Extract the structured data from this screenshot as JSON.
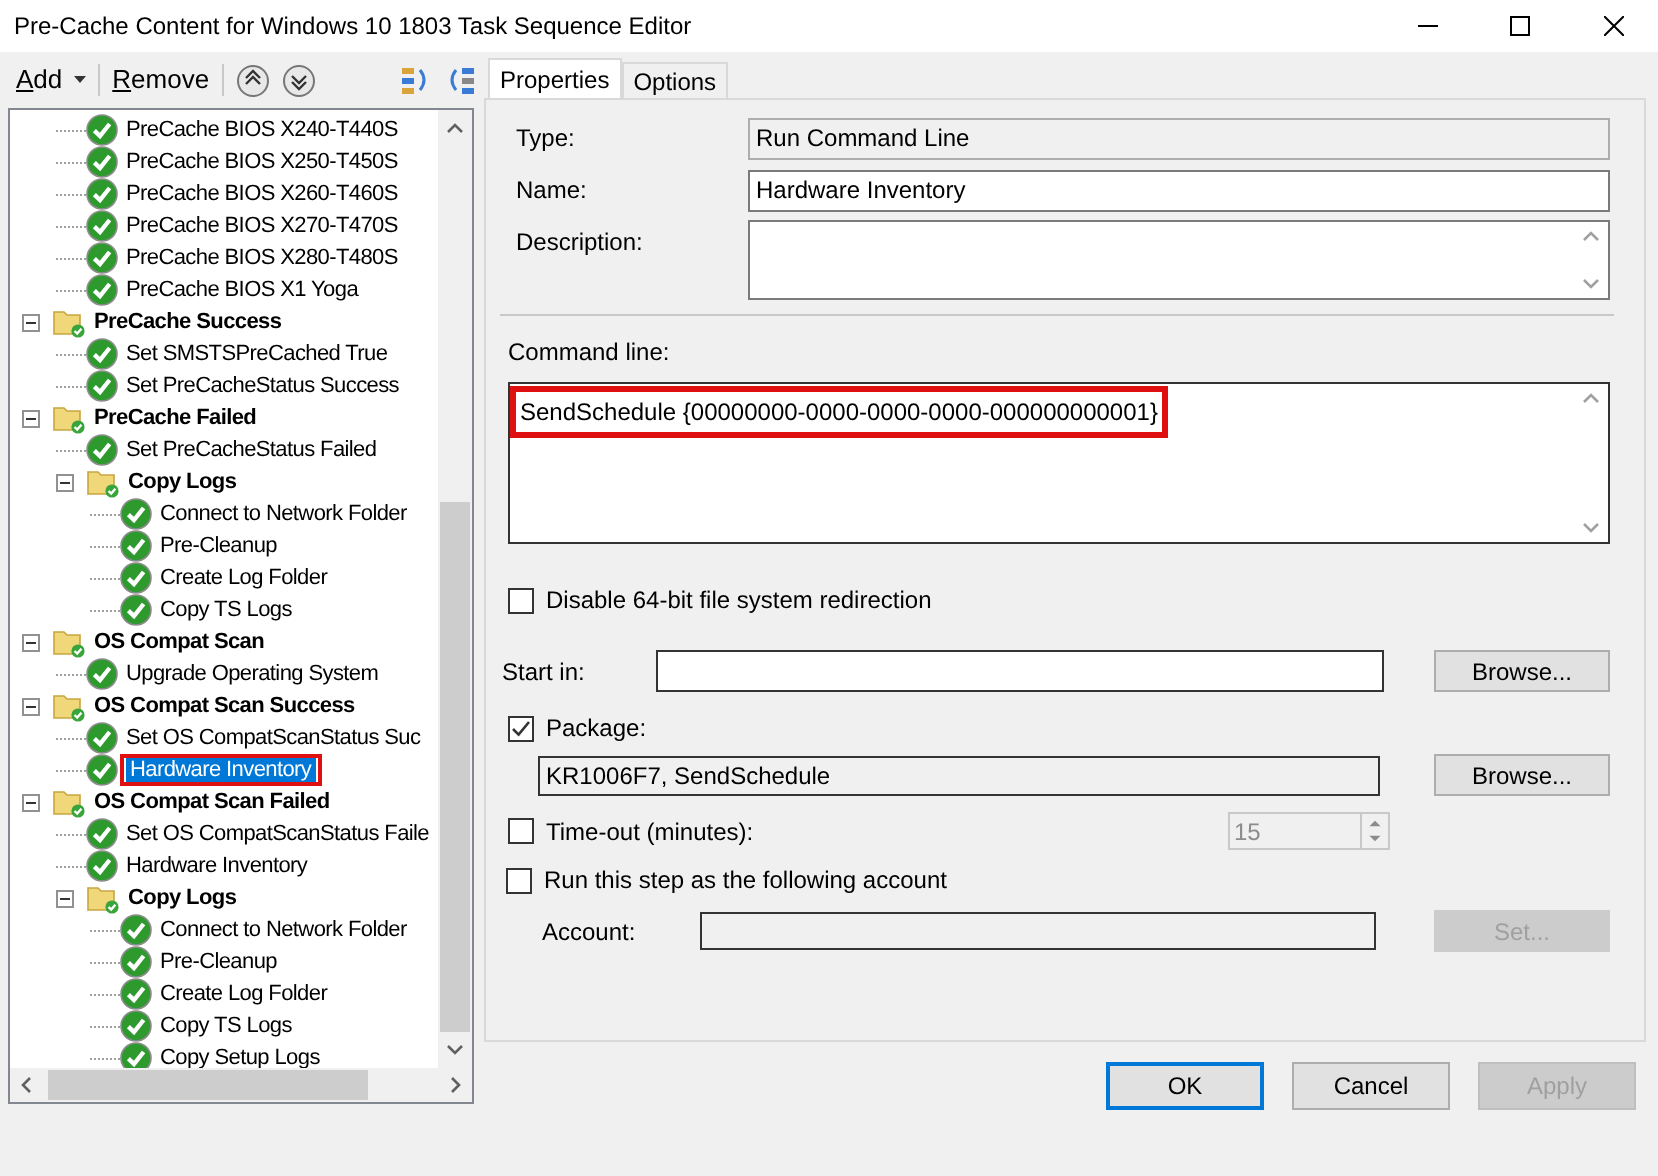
{
  "window": {
    "title": "Pre-Cache Content for Windows 10 1803 Task Sequence Editor"
  },
  "toolbar": {
    "add": "Add",
    "remove": "Remove"
  },
  "tree": {
    "scrolled_items": [
      {
        "label": "PreCache BIOS X240-T440S",
        "kind": "step",
        "selected": false
      },
      {
        "label": "PreCache BIOS X250-T450S",
        "kind": "step",
        "selected": false
      },
      {
        "label": "PreCache BIOS X260-T460S",
        "kind": "step",
        "selected": false
      },
      {
        "label": "PreCache BIOS X270-T470S",
        "kind": "step",
        "selected": false
      },
      {
        "label": "PreCache BIOS X280-T480S",
        "kind": "step",
        "selected": false
      },
      {
        "label": "PreCache BIOS X1 Yoga",
        "kind": "step",
        "selected": false
      }
    ],
    "items": [
      {
        "label": "PreCache Success",
        "kind": "group",
        "expanded": true,
        "selected": false,
        "children": [
          {
            "label": "Set SMSTSPreCached True",
            "kind": "step",
            "selected": false
          },
          {
            "label": "Set PreCacheStatus Success",
            "kind": "step",
            "selected": false
          }
        ]
      },
      {
        "label": "PreCache Failed",
        "kind": "group",
        "expanded": true,
        "selected": false,
        "children": [
          {
            "label": "Set PreCacheStatus Failed",
            "kind": "step",
            "selected": false
          },
          {
            "label": "Copy Logs",
            "kind": "group",
            "expanded": true,
            "selected": false,
            "children": [
              {
                "label": "Connect to Network Folder",
                "kind": "step",
                "selected": false
              },
              {
                "label": "Pre-Cleanup",
                "kind": "step",
                "selected": false
              },
              {
                "label": "Create Log Folder",
                "kind": "step",
                "selected": false
              },
              {
                "label": "Copy TS Logs",
                "kind": "step",
                "selected": false
              }
            ]
          }
        ]
      },
      {
        "label": "OS Compat Scan",
        "kind": "group",
        "expanded": true,
        "selected": false,
        "children": [
          {
            "label": "Upgrade Operating System",
            "kind": "step",
            "selected": false
          }
        ]
      },
      {
        "label": "OS Compat Scan Success",
        "kind": "group",
        "expanded": true,
        "selected": false,
        "children": [
          {
            "label": "Set OS CompatScanStatus Suc",
            "kind": "step",
            "selected": false
          },
          {
            "label": "Hardware Inventory",
            "kind": "step",
            "selected": true
          }
        ]
      },
      {
        "label": "OS Compat Scan Failed",
        "kind": "group",
        "expanded": true,
        "selected": false,
        "children": [
          {
            "label": "Set OS CompatScanStatus Faile",
            "kind": "step",
            "selected": false
          },
          {
            "label": "Hardware Inventory",
            "kind": "step",
            "selected": false
          },
          {
            "label": "Copy Logs",
            "kind": "group",
            "expanded": true,
            "selected": false,
            "children": [
              {
                "label": "Connect to Network Folder",
                "kind": "step",
                "selected": false
              },
              {
                "label": "Pre-Cleanup",
                "kind": "step",
                "selected": false
              },
              {
                "label": "Create Log Folder",
                "kind": "step",
                "selected": false
              },
              {
                "label": "Copy TS Logs",
                "kind": "step",
                "selected": false
              },
              {
                "label": "Copy Setup Logs",
                "kind": "step",
                "selected": false
              }
            ]
          }
        ]
      }
    ]
  },
  "tabs": [
    {
      "label": "Properties",
      "selected": true
    },
    {
      "label": "Options",
      "selected": false
    }
  ],
  "properties": {
    "type": {
      "label": "Type:",
      "value": "Run Command Line"
    },
    "name": {
      "label": "Name:",
      "value": "Hardware Inventory"
    },
    "description": {
      "label": "Description:"
    },
    "command_line": {
      "label": "Command line:",
      "value": "SendSchedule {00000000-0000-0000-0000-000000000001}"
    },
    "disable_redirection": {
      "label": "Disable 64-bit file system redirection",
      "checked": false
    },
    "start_in": {
      "label": "Start in:",
      "browse": "Browse..."
    },
    "package": {
      "label": "Package:",
      "checked": true,
      "value": "KR1006F7, SendSchedule",
      "browse": "Browse..."
    },
    "timeout": {
      "label": "Time-out (minutes):",
      "checked": false,
      "value": "15"
    },
    "run_as": {
      "label": "Run this step as the following account",
      "checked": false
    },
    "account": {
      "label": "Account:",
      "button": "Set..."
    }
  },
  "buttons": [
    {
      "label": "OK",
      "disabled": false,
      "default": true
    },
    {
      "label": "Cancel",
      "disabled": false,
      "default": false
    },
    {
      "label": "Apply",
      "disabled": true,
      "default": false
    }
  ]
}
